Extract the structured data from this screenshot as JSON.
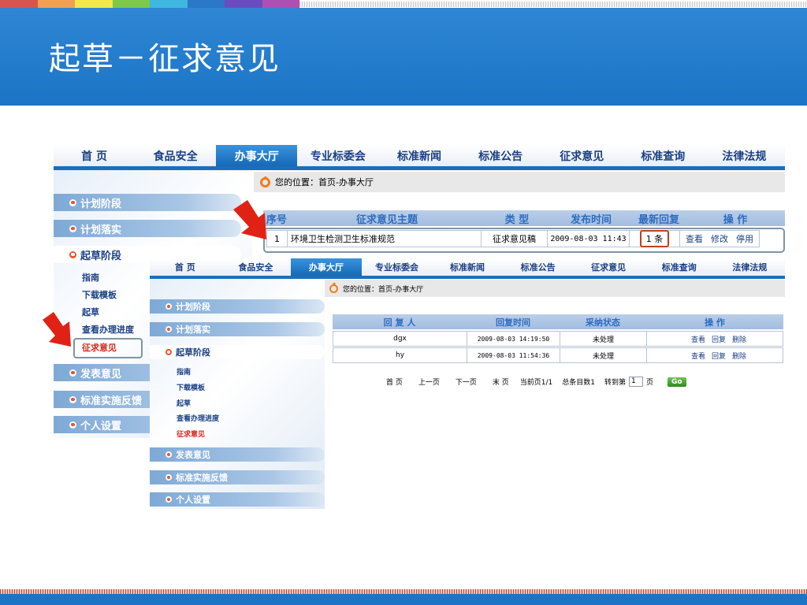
{
  "slide": {
    "title": "起草－征求意见",
    "strip_colors": [
      "#d9534f",
      "#f0a050",
      "#f2e84a",
      "#7cc94b",
      "#3fb7e0",
      "#2b78c8",
      "#6b4cc0",
      "#b04fb3"
    ]
  },
  "back": {
    "nav": [
      "首  页",
      "食品安全",
      "办事大厅",
      "专业标委会",
      "标准新闻",
      "标准公告",
      "征求意见",
      "标准查询",
      "法律法规"
    ],
    "active_nav": 2,
    "crumb": "您的位置：首页-办事大厅",
    "sidebar": {
      "items": [
        "计划阶段",
        "计划落实",
        "起草阶段",
        "发表意见",
        "标准实施反馈",
        "个人设置"
      ],
      "subitems": [
        "指南",
        "下载模板",
        "起草",
        "查看办理进度",
        "征求意见"
      ]
    },
    "table": {
      "headers": [
        "序号",
        "征求意见主题",
        "类    型",
        "发布时间",
        "最新回复",
        "操    作"
      ],
      "row": {
        "no": "1",
        "topic": "环境卫生检测卫生标准规范",
        "type": "征求意见稿",
        "time": "2009-08-03 11:43",
        "reply": "1 条",
        "actions": [
          "查看",
          "修改",
          "停用"
        ]
      }
    }
  },
  "front": {
    "nav": [
      "首  页",
      "食品安全",
      "办事大厅",
      "专业标委会",
      "标准新闻",
      "标准公告",
      "征求意见",
      "标准查询",
      "法律法规"
    ],
    "active_nav": 2,
    "crumb": "您的位置：首页-办事大厅",
    "sidebar": {
      "items": [
        "计划阶段",
        "计划落实",
        "起草阶段",
        "发表意见",
        "标准实施反馈",
        "个人设置"
      ],
      "subitems": [
        "指南",
        "下载模板",
        "起草",
        "查看办理进度",
        "征求意见"
      ]
    },
    "table": {
      "headers": [
        "回 复 人",
        "回复时间",
        "采纳状态",
        "操    作"
      ],
      "rows": [
        {
          "person": "dgx",
          "time": "2009-08-03 14:19:50",
          "status": "未处理",
          "actions": [
            "查看",
            "回复",
            "删除"
          ]
        },
        {
          "person": "hy",
          "time": "2009-08-03 11:54:36",
          "status": "未处理",
          "actions": [
            "查看",
            "回复",
            "删除"
          ]
        }
      ]
    },
    "pager": {
      "first": "首 页",
      "prev": "上一页",
      "next": "下一页",
      "last": "末 页",
      "current": "当前页1/1",
      "total": "总条目数1",
      "goto": "转到第",
      "page_value": "1",
      "page_unit": "页",
      "go": "Go"
    }
  }
}
